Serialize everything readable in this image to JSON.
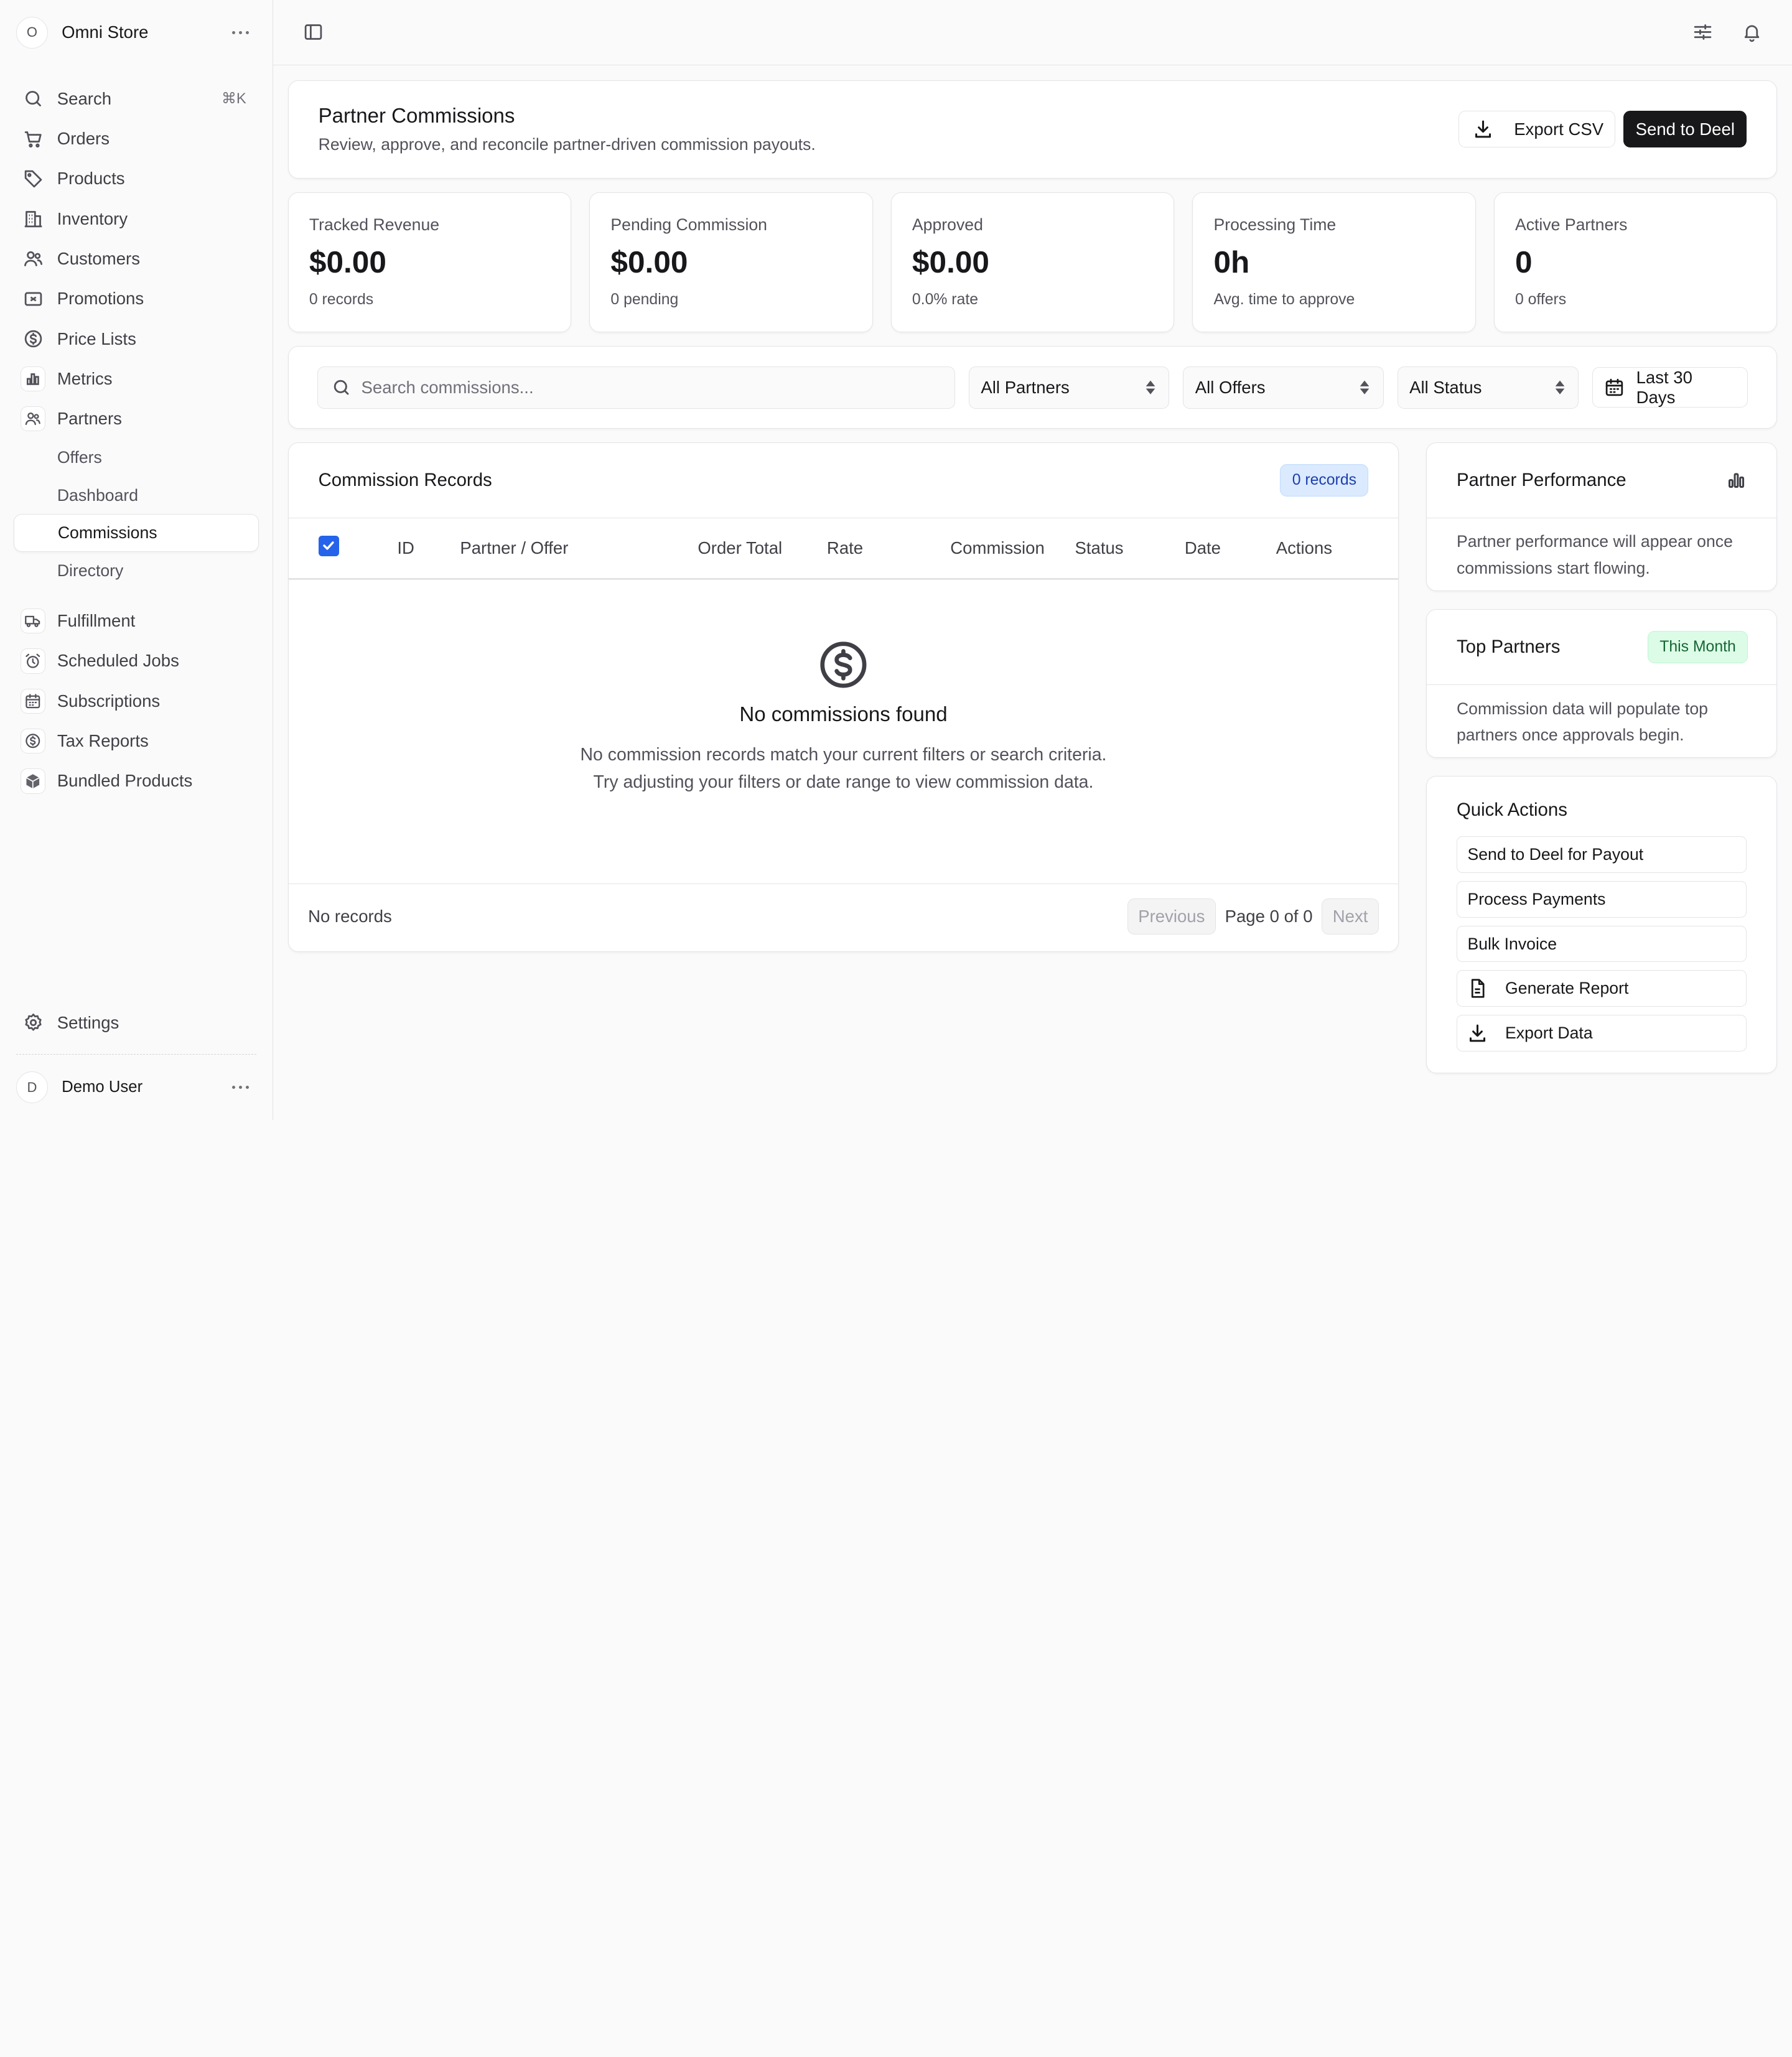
{
  "sidebar": {
    "store": {
      "initial": "O",
      "name": "Omni Store"
    },
    "items": [
      {
        "label": "Search",
        "shortcut": "⌘K",
        "icon": "search-icon"
      },
      {
        "label": "Orders",
        "icon": "cart-icon"
      },
      {
        "label": "Products",
        "icon": "tag-icon"
      },
      {
        "label": "Inventory",
        "icon": "building-icon"
      },
      {
        "label": "Customers",
        "icon": "users-icon"
      },
      {
        "label": "Promotions",
        "icon": "ticket-icon"
      },
      {
        "label": "Price Lists",
        "icon": "dollar-circle-icon"
      },
      {
        "label": "Metrics",
        "icon": "bar-chart-icon"
      },
      {
        "label": "Partners",
        "icon": "users-icon"
      }
    ],
    "partner_sub": [
      "Offers",
      "Dashboard",
      "Commissions",
      "Directory"
    ],
    "items2": [
      {
        "label": "Fulfillment",
        "icon": "truck-icon"
      },
      {
        "label": "Scheduled Jobs",
        "icon": "alarm-icon"
      },
      {
        "label": "Subscriptions",
        "icon": "calendar-icon"
      },
      {
        "label": "Tax Reports",
        "icon": "dollar-circle-icon"
      },
      {
        "label": "Bundled Products",
        "icon": "box-icon"
      }
    ],
    "settings": "Settings",
    "user": {
      "initial": "D",
      "name": "Demo User"
    }
  },
  "header": {
    "title": "Partner Commissions",
    "subtitle": "Review, approve, and reconcile partner-driven commission payouts.",
    "export_label": "Export CSV",
    "send_label": "Send to Deel"
  },
  "stats": [
    {
      "label": "Tracked Revenue",
      "value": "$0.00",
      "sub": "0 records"
    },
    {
      "label": "Pending Commission",
      "value": "$0.00",
      "sub": "0 pending"
    },
    {
      "label": "Approved",
      "value": "$0.00",
      "sub": "0.0% rate"
    },
    {
      "label": "Processing Time",
      "value": "0h",
      "sub": "Avg. time to approve"
    },
    {
      "label": "Active Partners",
      "value": "0",
      "sub": "0 offers"
    }
  ],
  "filters": {
    "search_placeholder": "Search commissions...",
    "partners": "All Partners",
    "offers": "All Offers",
    "status": "All Status",
    "date": "Last 30 Days"
  },
  "records": {
    "title": "Commission Records",
    "badge": "0 records",
    "columns": [
      "ID",
      "Partner / Offer",
      "Order Total",
      "Rate",
      "Commission",
      "Status",
      "Date",
      "Actions"
    ],
    "empty_title": "No commissions found",
    "empty_line1": "No commission records match your current filters or search criteria.",
    "empty_line2": "Try adjusting your filters or date range to view commission data.",
    "footer": "No records",
    "prev": "Previous",
    "page": "Page 0 of 0",
    "next": "Next"
  },
  "performance": {
    "title": "Partner Performance",
    "line1": "Partner performance will appear once",
    "line2": "commissions start flowing."
  },
  "top_partners": {
    "title": "Top Partners",
    "badge": "This Month",
    "line1": "Commission data will populate top",
    "line2": "partners once approvals begin."
  },
  "quick_actions": {
    "title": "Quick Actions",
    "items": [
      "Send to Deel for Payout",
      "Process Payments",
      "Bulk Invoice",
      "Generate Report",
      "Export Data"
    ]
  },
  "colors": {
    "accent": "#2563eb",
    "dark_button": "#18181b",
    "badge_blue": "#dbeafe",
    "badge_green": "#dcfce7"
  }
}
